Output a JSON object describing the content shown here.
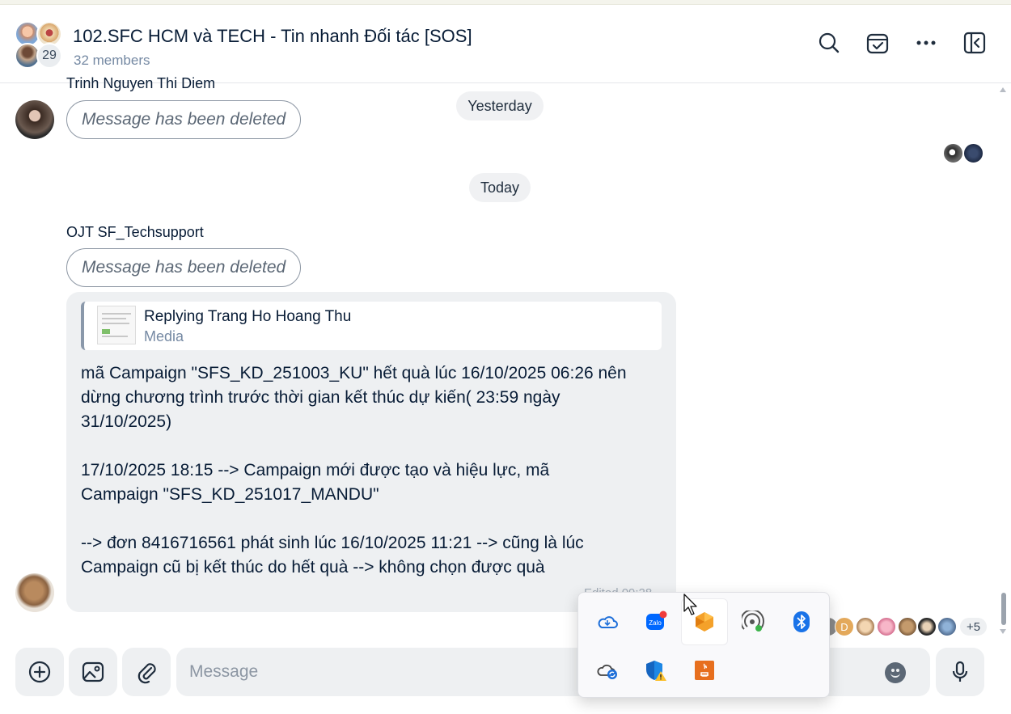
{
  "header": {
    "title": "102.SFC HCM và TECH - Tin nhanh Đối tác [SOS]",
    "members": "32 members",
    "avatar_count": "29"
  },
  "chat": {
    "partial_sender": "Trinh Nguyen Thi Diem",
    "deleted_text": "Message has been deleted",
    "date_yesterday": "Yesterday",
    "date_today": "Today",
    "sender": "OJT SF_Techsupport",
    "reply": {
      "title": "Replying Trang Ho Hoang Thu",
      "subtitle": "Media"
    },
    "message_lines": [
      "mã Campaign \"SFS_KD_251003_KU\" hết quà lúc 16/10/2025 06:26 nên",
      "dừng chương trình trước thời gian kết thúc dự kiến( 23:59 ngày",
      "31/10/2025)",
      "",
      "17/10/2025 18:15 --> Campaign mới được tạo và hiệu lực, mã",
      "Campaign \"SFS_KD_251017_MANDU\"",
      "",
      "--> đơn 8416716561 phát sinh lúc 16/10/2025 11:21 --> cũng là lúc",
      "Campaign cũ bị kết thúc do hết quà --> không chọn được quà"
    ],
    "edited_time": "Edited  09:28",
    "reactors_more": "+5",
    "reactor_letter": "D"
  },
  "composer": {
    "placeholder": "Message"
  },
  "tray_icons": [
    "onedrive-icon",
    "zalo-icon",
    "sublime-icon",
    "hotspot-icon",
    "bluetooth-icon",
    "cloud-sync-icon",
    "defender-warning-icon",
    "java-icon"
  ],
  "colors": {
    "accent": "#0068ff",
    "bubble_bg": "#eef0f2",
    "muted_text": "#7589a3"
  }
}
